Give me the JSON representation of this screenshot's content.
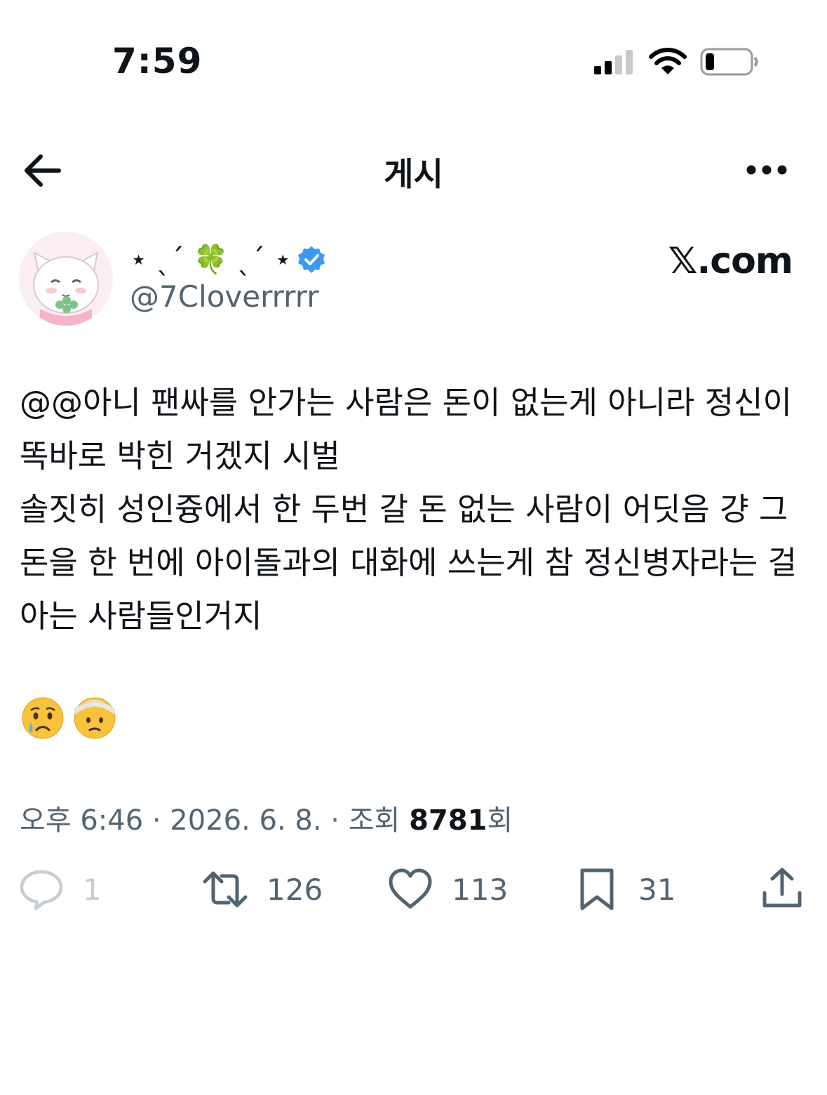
{
  "status_bar": {
    "time": "7:59"
  },
  "header": {
    "title": "게시"
  },
  "author": {
    "display_name": "⋆ ˎˊ 🍀 ˎˊ ⋆",
    "handle": "@7Cloverrrrr",
    "verified": true,
    "verified_color": "#3b99f0"
  },
  "source_watermark": "𝕏.com",
  "tweet": {
    "text": "@@아니 팬싸를 안가는 사람은 돈이 없는게 아니라 정신이 똑바로 박힌 거겠지 시벌\n솔짓히 성인즁에서 한 두번 갈 돈 없는 사람이 어딧음 걍 그 돈을 한 번에 아이돌과의 대화에 쓰는게 참 정신병자라는 걸 아는 사람들인거지",
    "emojis": [
      "crying-face",
      "face-with-head-bandage"
    ]
  },
  "meta": {
    "time": "오후 6:46",
    "separator": " · ",
    "date": "2026. 6. 8.",
    "views_label": "조회 ",
    "views_count": "8781",
    "views_suffix": "회"
  },
  "actions": {
    "reply_count": "1",
    "retweet_count": "126",
    "like_count": "113",
    "bookmark_count": "31"
  },
  "colors": {
    "text": "#0f1419",
    "secondary": "#536471",
    "disabled": "#c5ccd3"
  }
}
